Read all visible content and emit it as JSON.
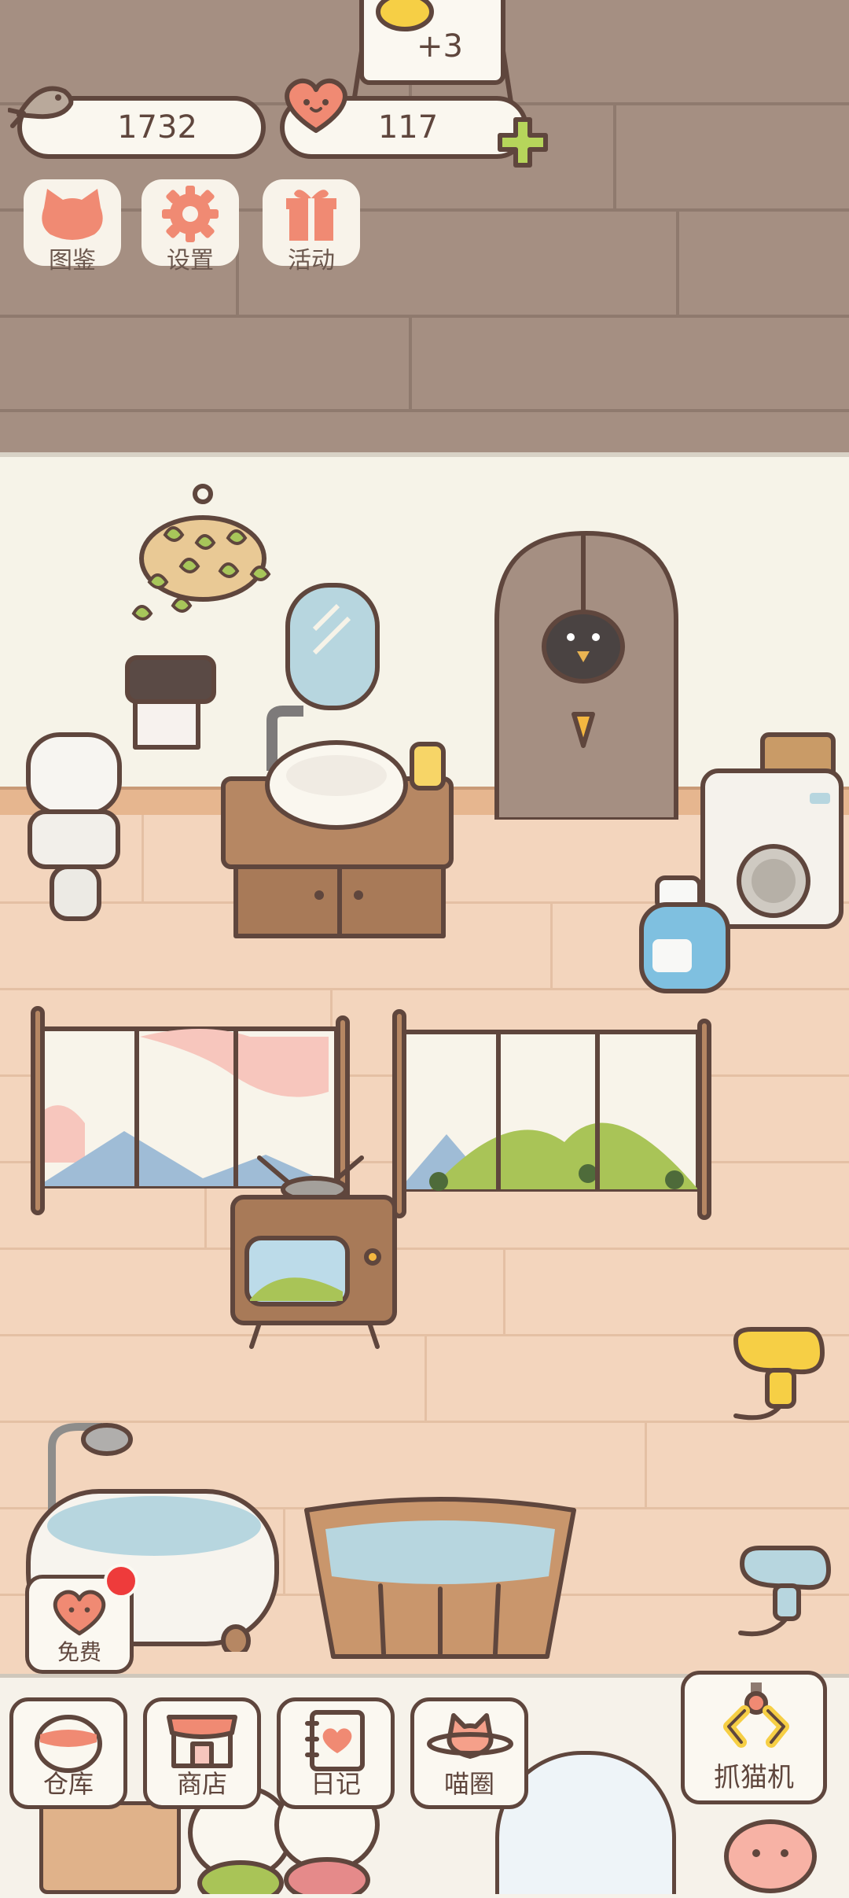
{
  "currency": {
    "fish": "1732",
    "hearts": "117",
    "sign_bonus": "+3"
  },
  "top_menu": [
    {
      "label": "图鉴",
      "icon": "cat-head-icon"
    },
    {
      "label": "设置",
      "icon": "gear-icon"
    },
    {
      "label": "活动",
      "icon": "gift-icon"
    }
  ],
  "free_button": {
    "label": "免费",
    "icon": "heart-icon"
  },
  "bottom_nav": [
    {
      "label": "仓库",
      "icon": "storage-jar-icon"
    },
    {
      "label": "商店",
      "icon": "shop-icon"
    },
    {
      "label": "日记",
      "icon": "diary-icon"
    },
    {
      "label": "喵圈",
      "icon": "cat-planet-icon"
    }
  ],
  "claw_machine": {
    "label": "抓猫机",
    "icon": "claw-icon"
  },
  "colors": {
    "outline": "#5f463d",
    "accent_coral": "#f08a73",
    "accent_green": "#b6d55b",
    "ceiling": "#a58f82",
    "floor": "#f3d5bd"
  }
}
